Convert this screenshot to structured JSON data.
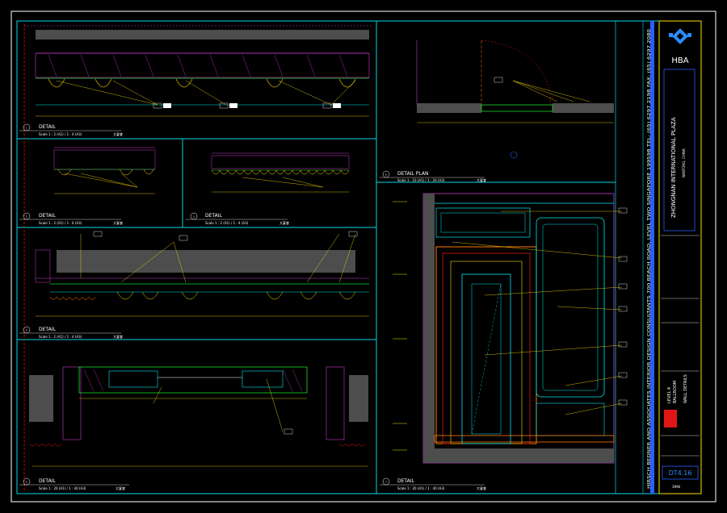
{
  "sheet": {
    "background": "#000000",
    "colors": {
      "border": "#ffffff",
      "frame": "#00d8e6",
      "wall": "#00e5ee",
      "magenta": "#c63ac6",
      "green": "#1cdc2a",
      "yellow": "#ffe000",
      "orange": "#ff7a00",
      "red": "#e01616",
      "blue": "#2a5fff",
      "gray": "#4d4d4d"
    }
  },
  "details": [
    {
      "number": "1",
      "title": "DETAIL",
      "scale": "Scale 1 : 2 (A1) / 1 : 4 (A3)",
      "cn": "大宴會"
    },
    {
      "number": "2",
      "title": "DETAIL",
      "scale": "Scale 1 : 2 (A1) / 1 : 4 (A3)",
      "cn": "大宴會"
    },
    {
      "number": "3",
      "title": "DETAIL",
      "scale": "Scale 1 : 2 (A1) / 1 : 4 (A3)",
      "cn": "大宴會"
    },
    {
      "number": "4",
      "title": "DETAIL",
      "scale": "Scale 1 : 2 (A1) / 1 : 4 (A3)",
      "cn": "大宴會"
    },
    {
      "number": "5",
      "title": "DETAIL",
      "scale": "Scale 1 : 20 (A1) / 1 : 40 (A3)",
      "cn": "大宴會"
    },
    {
      "number": "6",
      "title": "DETAIL PLAN",
      "scale": "Scale 1 : 10 (A1) / 1 : 20 (A3)",
      "cn": "大宴會"
    },
    {
      "number": "7",
      "title": "DETAIL",
      "scale": "Scale 1 : 20 (A1) / 1 : 40 (A3)",
      "cn": "大宴會"
    }
  ],
  "consultant_strip": {
    "text": "HIRSCH BEDNER AND ASSOCIATES   INTERIOR DESIGN CONSULTANTS   700 BEACH ROAD, LEVEL TWO   SINGAPORE 199598   TEL: (65) 6297 2198   FAX: (65) 6297 2080"
  },
  "title_block": {
    "logo_text": "HBA",
    "project": "ZHONGNAN INTERNATIONAL PLAZA",
    "location": "NANTONG, CHINA",
    "level": "LEVEL 4",
    "room": "BALLROOM",
    "sheet_title": "WALL DETAILS",
    "drawing_no": "DT4.16",
    "small_code": "3996"
  }
}
